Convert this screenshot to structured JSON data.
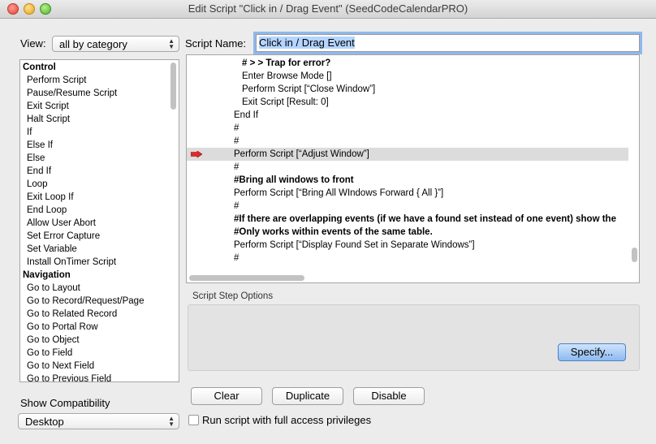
{
  "window": {
    "title": "Edit Script \"Click in / Drag Event\" (SeedCodeCalendarPRO)"
  },
  "view": {
    "label": "View:",
    "selected": "all by category"
  },
  "script_name": {
    "label": "Script Name:",
    "value": "Click in / Drag Event"
  },
  "steps": [
    {
      "text": "Control",
      "category": true
    },
    {
      "text": "Perform Script"
    },
    {
      "text": "Pause/Resume Script"
    },
    {
      "text": "Exit Script"
    },
    {
      "text": "Halt Script"
    },
    {
      "text": "If"
    },
    {
      "text": "Else If"
    },
    {
      "text": "Else"
    },
    {
      "text": "End If"
    },
    {
      "text": "Loop"
    },
    {
      "text": "Exit Loop If"
    },
    {
      "text": "End Loop"
    },
    {
      "text": "Allow User Abort"
    },
    {
      "text": "Set Error Capture"
    },
    {
      "text": "Set Variable"
    },
    {
      "text": "Install OnTimer Script"
    },
    {
      "text": "Navigation",
      "category": true
    },
    {
      "text": "Go to Layout"
    },
    {
      "text": "Go to Record/Request/Page"
    },
    {
      "text": "Go to Related Record"
    },
    {
      "text": "Go to Portal Row"
    },
    {
      "text": "Go to Object"
    },
    {
      "text": "Go to Field"
    },
    {
      "text": "Go to Next Field"
    },
    {
      "text": "Go to Previous Field"
    }
  ],
  "script_lines": [
    {
      "text": "# > > Trap for error?",
      "indent": 2,
      "bold": true
    },
    {
      "text": "Enter Browse Mode []",
      "indent": 2
    },
    {
      "text": "Perform Script [“Close Window”]",
      "indent": 2
    },
    {
      "text": "Exit Script [Result: 0]",
      "indent": 2
    },
    {
      "text": "End If",
      "indent": 1
    },
    {
      "text": "#",
      "indent": 1
    },
    {
      "text": "#",
      "indent": 1
    },
    {
      "text": "Perform Script [“Adjust Window”]",
      "indent": 1,
      "highlighted": true,
      "marker": true
    },
    {
      "text": "#",
      "indent": 1
    },
    {
      "text": "#Bring all windows to front",
      "indent": 1,
      "bold": true
    },
    {
      "text": "Perform Script [“Bring All WIndows Forward { All }”]",
      "indent": 1
    },
    {
      "text": "#",
      "indent": 1
    },
    {
      "text": "#If there are overlapping events (if we have a found set instead of one event) show the",
      "indent": 1,
      "bold": true
    },
    {
      "text": "#Only works within events of the same table.",
      "indent": 1,
      "bold": true
    },
    {
      "text": "Perform Script [“Display Found Set in Separate Windows”]",
      "indent": 1
    },
    {
      "text": "#",
      "indent": 1
    }
  ],
  "step_options": {
    "label": "Script Step Options",
    "specify_button": "Specify..."
  },
  "buttons": {
    "clear": "Clear",
    "duplicate": "Duplicate",
    "disable": "Disable"
  },
  "compatibility": {
    "label": "Show Compatibility",
    "selected": "Desktop"
  },
  "full_access": {
    "label": "Run script with full access privileges",
    "checked": false
  },
  "colors": {
    "highlight_row": "#dcdcdc",
    "focus_ring": "#8fb8ee",
    "marker_red": "#e02a2a"
  },
  "icons": {
    "current_line_marker": "red-arrow-icon"
  }
}
